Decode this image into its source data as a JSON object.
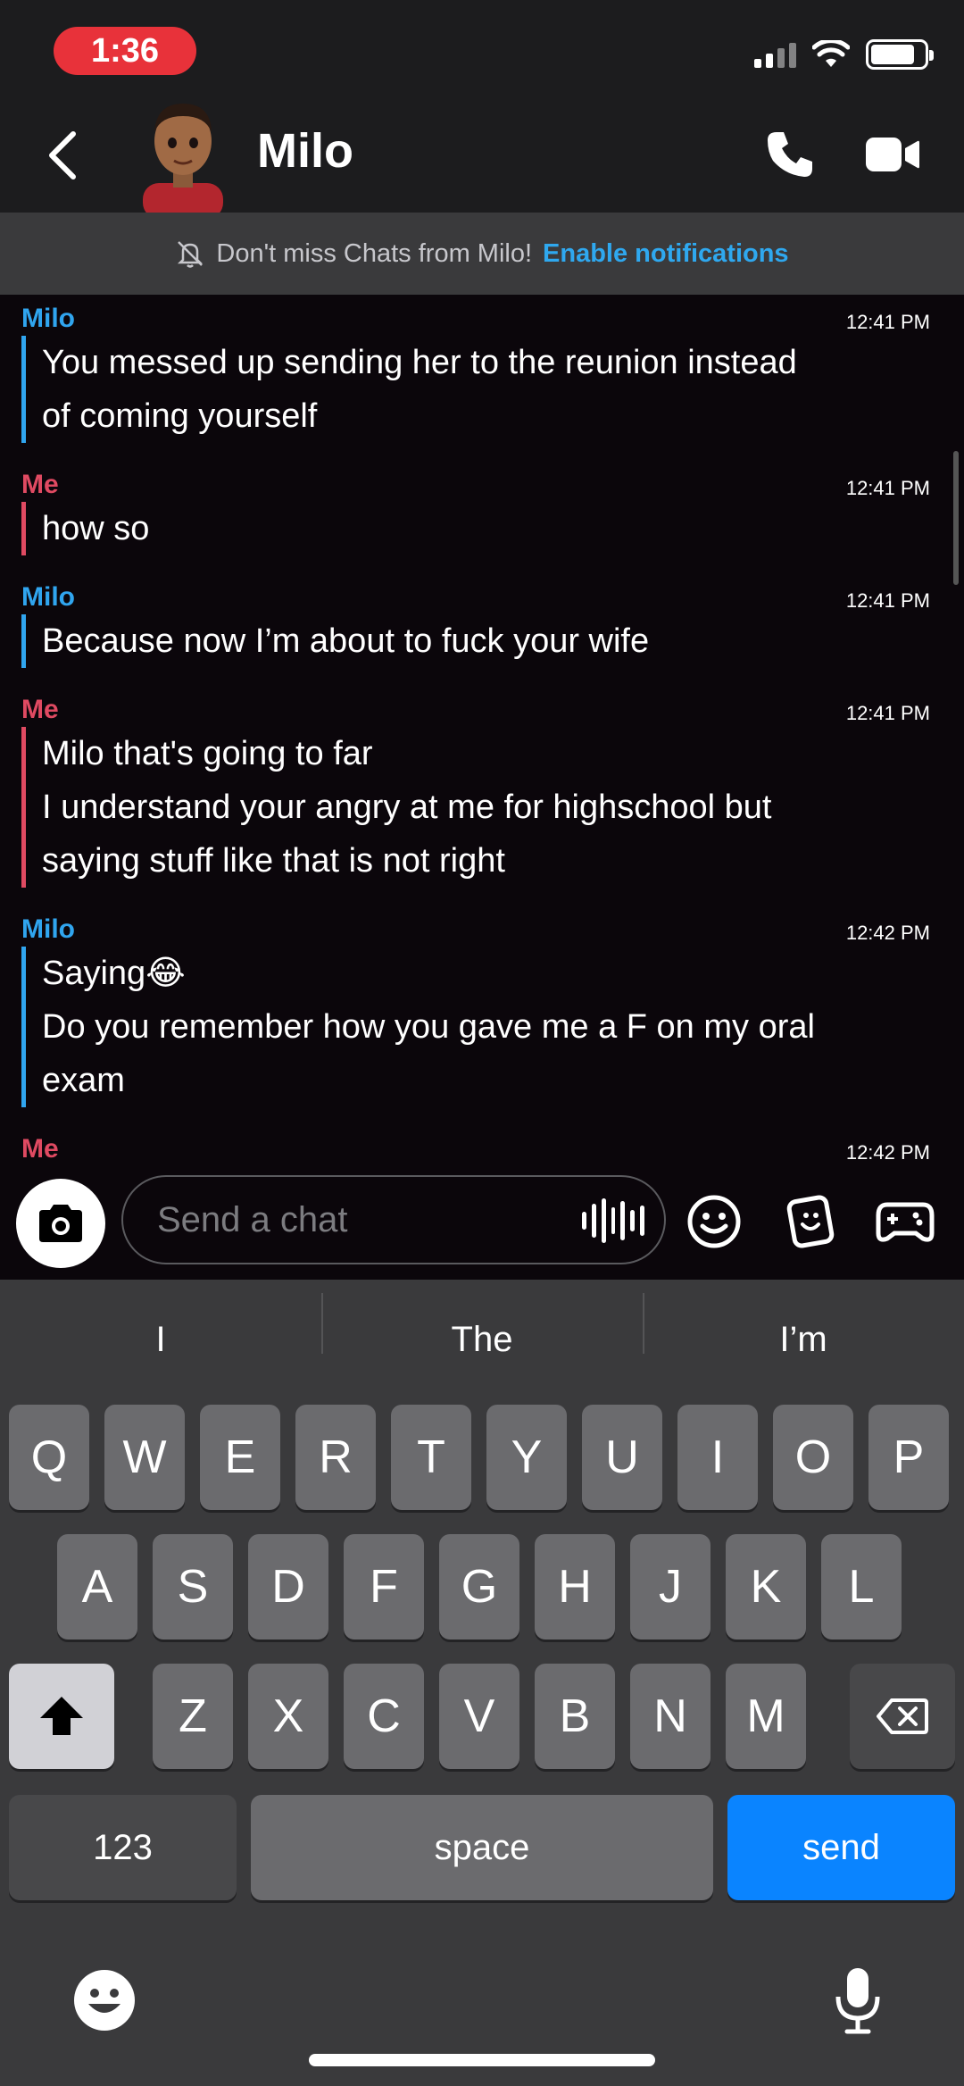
{
  "status_bar": {
    "time": "1:36"
  },
  "header": {
    "contact_name": "Milo"
  },
  "banner": {
    "text": "Don't miss Chats from Milo!",
    "link": "Enable notifications"
  },
  "messages": [
    {
      "sender": "Milo",
      "time": "12:41 PM",
      "lines": [
        "You messed up sending her to the reunion instead",
        "of coming yourself"
      ]
    },
    {
      "sender": "Me",
      "time": "12:41 PM",
      "lines": [
        "how so"
      ]
    },
    {
      "sender": "Milo",
      "time": "12:41 PM",
      "lines": [
        "Because now I’m about to fuck your wife"
      ]
    },
    {
      "sender": "Me",
      "time": "12:41 PM",
      "lines": [
        "Milo that's going to far",
        "I understand your angry at me for highschool but",
        "saying stuff like that is not right"
      ]
    },
    {
      "sender": "Milo",
      "time": "12:42 PM",
      "lines": [
        "Saying😂",
        "Do you remember how you gave me a F on my oral",
        "exam"
      ]
    },
    {
      "sender": "Me",
      "time": "12:42 PM",
      "lines": []
    }
  ],
  "input": {
    "placeholder": "Send a chat"
  },
  "keyboard": {
    "suggestions": [
      "I",
      "The",
      "I’m"
    ],
    "row1": [
      "Q",
      "W",
      "E",
      "R",
      "T",
      "Y",
      "U",
      "I",
      "O",
      "P"
    ],
    "row2": [
      "A",
      "S",
      "D",
      "F",
      "G",
      "H",
      "J",
      "K",
      "L"
    ],
    "row3": [
      "Z",
      "X",
      "C",
      "V",
      "B",
      "N",
      "M"
    ],
    "numbers_label": "123",
    "space_label": "space",
    "send_label": "send"
  },
  "icons": {
    "back": "chevron-left-icon",
    "call": "phone-icon",
    "video": "video-camera-icon",
    "bell_off": "bell-off-icon",
    "camera": "camera-icon",
    "voice": "voice-waveform-icon",
    "emoji": "smiley-icon",
    "memories": "stickers-icon",
    "games": "gamepad-icon",
    "shift": "shift-arrow-icon",
    "delete": "backspace-icon",
    "emoji_keyboard": "emoji-keyboard-icon",
    "mic": "microphone-icon"
  },
  "colors": {
    "milo": "#30a5ef",
    "me": "#e04a62",
    "time_pill": "#e8323a",
    "send_key": "#0a84ff"
  }
}
